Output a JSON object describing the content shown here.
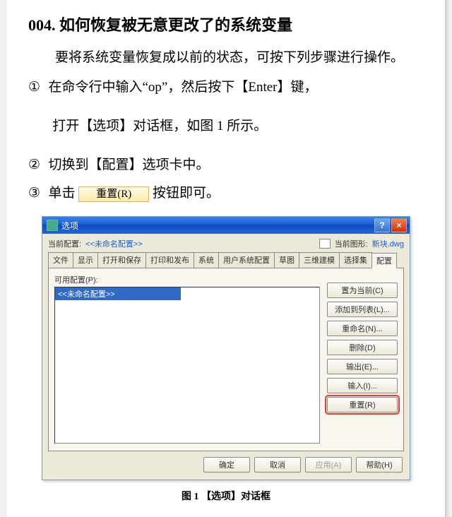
{
  "article": {
    "number": "004.",
    "title": "如何恢复被无意更改了的系统变量",
    "intro": "要将系统变量恢复成以前的状态，可按下列步骤进行操作。",
    "steps": [
      {
        "num": "①",
        "text_a": "在命令行中输入“op”，然后按下【Enter】键，",
        "text_b": "打开【选项】对话框，如图 1 所示。"
      },
      {
        "num": "②",
        "text_a": "切换到【配置】选项卡中。"
      },
      {
        "num": "③",
        "text_a": "单击",
        "text_b": "按钮即可。"
      }
    ],
    "inline_button": "重置(R)",
    "caption": "图 1 【选项】对话框"
  },
  "dialog": {
    "title": "选项",
    "top": {
      "label1": "当前配置:",
      "value1": "<<未命名配置>>",
      "label2": "当前图形:",
      "value2": "新块.dwg"
    },
    "tabs": [
      "文件",
      "显示",
      "打开和保存",
      "打印和发布",
      "系统",
      "用户系统配置",
      "草图",
      "三维建模",
      "选择集",
      "配置"
    ],
    "active_tab_index": 9,
    "left_label": "可用配置(P):",
    "list_item": "<<未命名配置>>",
    "side_buttons": [
      "置为当前(C)",
      "添加到列表(L)...",
      "重命名(N)...",
      "删除(D)",
      "输出(E)...",
      "输入(I)...",
      "重置(R)"
    ],
    "highlight_index": 6,
    "bottom_buttons": {
      "ok": "确定",
      "cancel": "取消",
      "apply": "应用(A)",
      "help": "帮助(H)"
    }
  }
}
